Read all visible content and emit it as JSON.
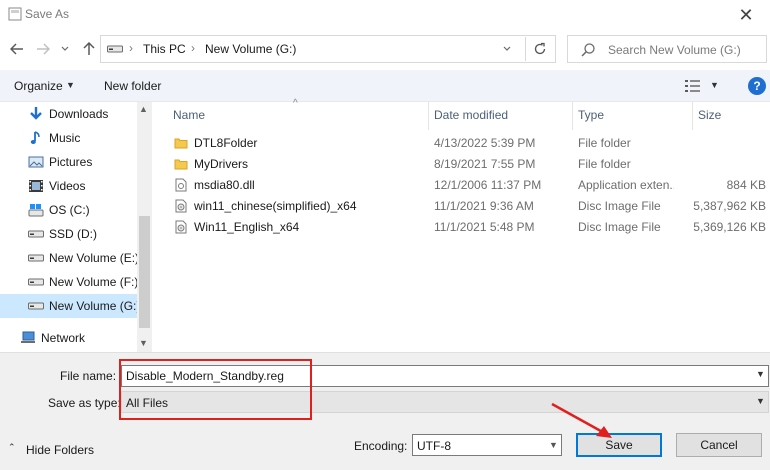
{
  "window": {
    "title": "Save As",
    "close_glyph": "✕"
  },
  "address": {
    "crumbs": [
      "This PC",
      "New Volume (G:)"
    ],
    "separator": "›",
    "search_placeholder": "Search New Volume (G:)"
  },
  "toolbar": {
    "organize": "Organize",
    "new_folder": "New folder",
    "help": "?"
  },
  "nav": {
    "items": [
      {
        "label": "Downloads",
        "icon": "download-icon"
      },
      {
        "label": "Music",
        "icon": "music-icon"
      },
      {
        "label": "Pictures",
        "icon": "pictures-icon"
      },
      {
        "label": "Videos",
        "icon": "videos-icon"
      },
      {
        "label": "OS (C:)",
        "icon": "os-drive-icon"
      },
      {
        "label": "SSD (D:)",
        "icon": "drive-icon"
      },
      {
        "label": "New Volume (E:)",
        "icon": "drive-icon"
      },
      {
        "label": "New Volume (F:)",
        "icon": "drive-icon"
      },
      {
        "label": "New Volume (G:)",
        "icon": "drive-icon",
        "selected": true
      },
      {
        "label": "Network",
        "icon": "network-icon"
      }
    ]
  },
  "columns": {
    "name": "Name",
    "date": "Date modified",
    "type": "Type",
    "size": "Size"
  },
  "files": [
    {
      "name": "DTL8Folder",
      "date": "4/13/2022 5:39 PM",
      "type": "File folder",
      "size": "",
      "kind": "folder"
    },
    {
      "name": "MyDrivers",
      "date": "8/19/2021 7:55 PM",
      "type": "File folder",
      "size": "",
      "kind": "folder"
    },
    {
      "name": "msdia80.dll",
      "date": "12/1/2006 11:37 PM",
      "type": "Application exten...",
      "size": "884 KB",
      "kind": "dll"
    },
    {
      "name": "win11_chinese(simplified)_x64",
      "date": "11/1/2021 9:36 AM",
      "type": "Disc Image File",
      "size": "5,387,962 KB",
      "kind": "disc"
    },
    {
      "name": "Win11_English_x64",
      "date": "11/1/2021 5:48 PM",
      "type": "Disc Image File",
      "size": "5,369,126 KB",
      "kind": "disc"
    }
  ],
  "form": {
    "file_name_label": "File name:",
    "file_name_value": "Disable_Modern_Standby.reg",
    "save_as_type_label": "Save as type:",
    "save_as_type_value": "All Files",
    "encoding_label": "Encoding:",
    "encoding_value": "UTF-8",
    "hide_folders": "Hide Folders",
    "save": "Save",
    "cancel": "Cancel"
  },
  "colors": {
    "highlight": "#e0201f",
    "accent": "#0078d7",
    "selected_bg": "#cce8ff"
  }
}
